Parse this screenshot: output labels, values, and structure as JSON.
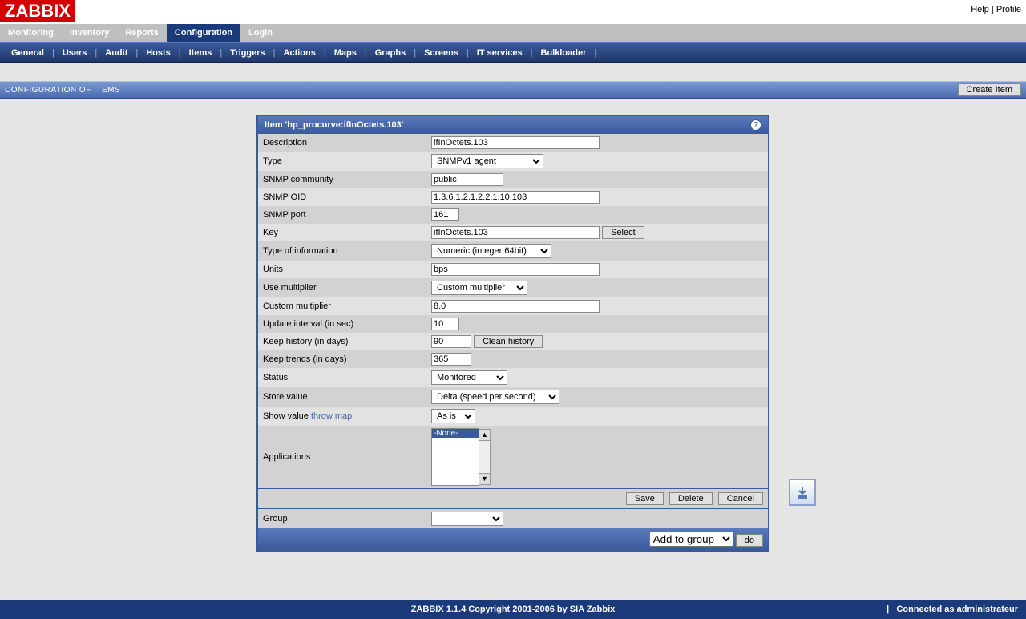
{
  "header": {
    "logo": "ZABBIX",
    "help": "Help",
    "profile": "Profile"
  },
  "tabs": [
    "Monitoring",
    "Inventory",
    "Reports",
    "Configuration",
    "Login"
  ],
  "active_tab": "Configuration",
  "subnav": [
    "General",
    "Users",
    "Audit",
    "Hosts",
    "Items",
    "Triggers",
    "Actions",
    "Maps",
    "Graphs",
    "Screens",
    "IT services",
    "Bulkloader"
  ],
  "page_title": "CONFIGURATION OF ITEMS",
  "create_button": "Create Item",
  "panel_title": "Item 'hp_procurve:ifInOctets.103'",
  "form": {
    "description": {
      "label": "Description",
      "value": "ifInOctets.103"
    },
    "type": {
      "label": "Type",
      "value": "SNMPv1 agent"
    },
    "snmp_community": {
      "label": "SNMP community",
      "value": "public"
    },
    "snmp_oid": {
      "label": "SNMP OID",
      "value": "1.3.6.1.2.1.2.2.1.10.103"
    },
    "snmp_port": {
      "label": "SNMP port",
      "value": "161"
    },
    "key": {
      "label": "Key",
      "value": "ifInOctets.103",
      "select_btn": "Select"
    },
    "type_info": {
      "label": "Type of information",
      "value": "Numeric (integer 64bit)"
    },
    "units": {
      "label": "Units",
      "value": "bps"
    },
    "use_multiplier": {
      "label": "Use multiplier",
      "value": "Custom multiplier"
    },
    "custom_multiplier": {
      "label": "Custom multiplier",
      "value": "8.0"
    },
    "update_interval": {
      "label": "Update interval (in sec)",
      "value": "10"
    },
    "keep_history": {
      "label": "Keep history (in days)",
      "value": "90",
      "clean_btn": "Clean history"
    },
    "keep_trends": {
      "label": "Keep trends (in days)",
      "value": "365"
    },
    "status": {
      "label": "Status",
      "value": "Monitored"
    },
    "store_value": {
      "label": "Store value",
      "value": "Delta (speed per second)"
    },
    "show_value": {
      "label": "Show value",
      "link": "throw map",
      "value": "As is"
    },
    "applications": {
      "label": "Applications",
      "selected": "-None-"
    }
  },
  "actions": {
    "save": "Save",
    "delete": "Delete",
    "cancel": "Cancel"
  },
  "group_row": {
    "label": "Group",
    "value": ""
  },
  "addgroup": {
    "select": "Add to group",
    "do": "do"
  },
  "footer": {
    "center": "ZABBIX 1.1.4 Copyright 2001-2006 by  SIA Zabbix",
    "right_sep": "|",
    "right": "Connected as administrateur"
  }
}
